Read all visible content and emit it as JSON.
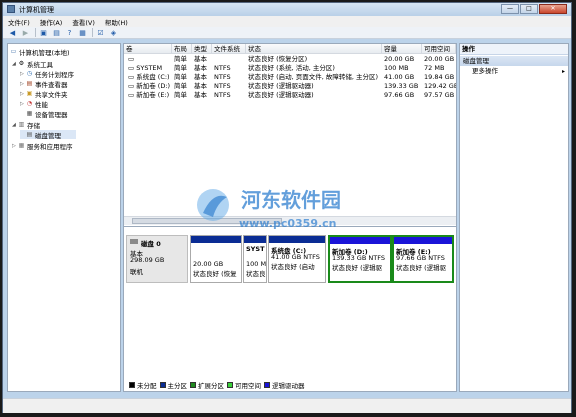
{
  "window": {
    "title": "计算机管理",
    "min": "—",
    "max": "□",
    "close": "✕"
  },
  "menu": [
    "文件(F)",
    "操作(A)",
    "查看(V)",
    "帮助(H)"
  ],
  "tree": {
    "root": "计算机管理(本地)",
    "items": [
      {
        "label": "系统工具",
        "level": 1,
        "expand": "◢",
        "icon": "⚙"
      },
      {
        "label": "任务计划程序",
        "level": 2,
        "expand": "▷",
        "icon": "◷"
      },
      {
        "label": "事件查看器",
        "level": 2,
        "expand": "▷",
        "icon": "▤"
      },
      {
        "label": "共享文件夹",
        "level": 2,
        "expand": "▷",
        "icon": "▣"
      },
      {
        "label": "性能",
        "level": 2,
        "expand": "▷",
        "icon": "◔"
      },
      {
        "label": "设备管理器",
        "level": 2,
        "expand": "",
        "icon": "▦"
      },
      {
        "label": "存储",
        "level": 1,
        "expand": "◢",
        "icon": "▥"
      },
      {
        "label": "磁盘管理",
        "level": 2,
        "expand": "",
        "icon": "▤",
        "selected": true
      },
      {
        "label": "服务和应用程序",
        "level": 1,
        "expand": "▷",
        "icon": "▦"
      }
    ]
  },
  "volumes": {
    "headers": [
      "卷",
      "布局",
      "类型",
      "文件系统",
      "状态",
      "容量",
      "可用空间"
    ],
    "rows": [
      [
        "",
        "简单",
        "基本",
        "",
        "状态良好 (恢复分区)",
        "20.00 GB",
        "20.00 GB"
      ],
      [
        "SYSTEM",
        "简单",
        "基本",
        "NTFS",
        "状态良好 (系统, 活动, 主分区)",
        "100 MB",
        "72 MB"
      ],
      [
        "系统盘 (C:)",
        "简单",
        "基本",
        "NTFS",
        "状态良好 (启动, 页面文件, 故障转储, 主分区)",
        "41.00 GB",
        "19.84 GB"
      ],
      [
        "新加卷 (D:)",
        "简单",
        "基本",
        "NTFS",
        "状态良好 (逻辑驱动器)",
        "139.33 GB",
        "129.42 GB"
      ],
      [
        "新加卷 (E:)",
        "简单",
        "基本",
        "NTFS",
        "状态良好 (逻辑驱动器)",
        "97.66 GB",
        "97.57 GB"
      ]
    ]
  },
  "disk": {
    "name": "磁盘 0",
    "type": "基本",
    "size": "298.09 GB",
    "status": "联机",
    "partitions": [
      {
        "title": "",
        "size": "20.00 GB",
        "status": "状态良好 (恢复",
        "bar": "#0a2c94"
      },
      {
        "title": "SYST",
        "size": "100 M",
        "status": "状态良",
        "bar": "#0a2c94"
      },
      {
        "title": "系统盘 (C:)",
        "size": "41.00 GB NTFS",
        "status": "状态良好 (启动",
        "bar": "#0a2c94"
      },
      {
        "title": "新加卷 (D:)",
        "size": "139.33 GB NTFS",
        "status": "状态良好 (逻辑驱",
        "bar": "#1a14d8"
      },
      {
        "title": "新加卷 (E:)",
        "size": "97.66 GB NTFS",
        "status": "状态良好 (逻辑驱",
        "bar": "#1a14d8"
      }
    ]
  },
  "legend": [
    {
      "label": "未分配",
      "color": "#000000"
    },
    {
      "label": "主分区",
      "color": "#0a2c94"
    },
    {
      "label": "扩展分区",
      "color": "#1f8a1f"
    },
    {
      "label": "可用空间",
      "color": "#3ad13a"
    },
    {
      "label": "逻辑驱动器",
      "color": "#1a14d8"
    }
  ],
  "actions": {
    "header": "操作",
    "section": "磁盘管理",
    "item": "更多操作",
    "arrow": "▸"
  },
  "watermark": {
    "text": "河东软件园",
    "url": "www.pc0359.cn"
  }
}
